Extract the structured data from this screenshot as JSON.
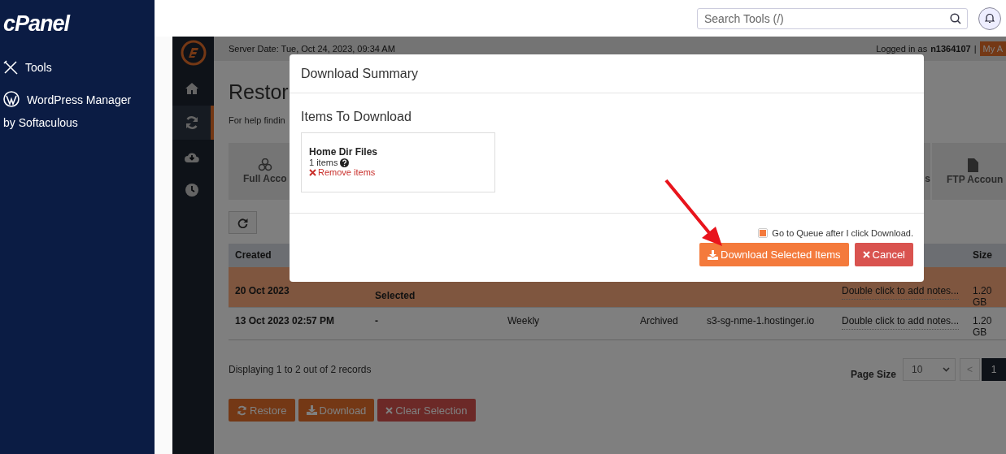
{
  "sidebar": {
    "logo": "cPanel",
    "items": [
      {
        "kind": "tools",
        "label": "Tools"
      },
      {
        "kind": "wordpress",
        "label": "WordPress Manager by Softaculous"
      }
    ]
  },
  "topbar": {
    "search": {
      "placeholder": "Search Tools (/)"
    }
  },
  "app_nav": {
    "items": [
      {
        "kind": "home",
        "selected": false
      },
      {
        "kind": "restore",
        "selected": true
      },
      {
        "kind": "download",
        "selected": false
      },
      {
        "kind": "schedule",
        "selected": false
      }
    ]
  },
  "server_bar": {
    "server_date": "Server Date: Tue, Oct 24, 2023, 09:34 AM",
    "logged_in_label": "Logged in as",
    "username": "n1364107",
    "separator": "|",
    "account_button": "My A"
  },
  "page": {
    "title": "Restor",
    "help": "For help findin"
  },
  "backup_tabs": [
    {
      "kind": "full",
      "label": "Full Acco"
    },
    {
      "kind": "plain",
      "label": "s"
    },
    {
      "kind": "file",
      "label": "FTP Accoun"
    }
  ],
  "table": {
    "created_label": "Created",
    "size_label": "Size",
    "rows": [
      {
        "selected": true,
        "created": "20 Oct 2023",
        "column_2": "Selected",
        "notes": "Double click to add notes...",
        "size": "1.20 GB"
      },
      {
        "selected": false,
        "created": "13 Oct 2023 02:57 PM",
        "column_2": "-",
        "type": "Weekly",
        "status": "Archived",
        "server": "s3-sg-nme-1.hostinger.io",
        "notes": "Double click to add notes...",
        "size": "1.20 GB"
      }
    ]
  },
  "records": "Displaying 1 to 2 out of 2 records",
  "pagination": {
    "page_size_label": "Page Size",
    "page_size": "10",
    "prev": "<",
    "pages": [
      {
        "label": "1",
        "selected": true
      }
    ]
  },
  "actions": [
    {
      "kind": "restore",
      "label": "Restore"
    },
    {
      "kind": "download",
      "label": "Download"
    },
    {
      "kind": "clear",
      "label": "Clear Selection"
    }
  ],
  "modal": {
    "title": "Download Summary",
    "section_title": "Items To Download",
    "items": [
      {
        "name": "Home Dir Files",
        "count": "1 items",
        "remove": "Remove items"
      }
    ],
    "queue_option": {
      "label": "Go to Queue after I click Download.",
      "checked": true
    },
    "buttons": [
      {
        "kind": "primary",
        "label": "Download Selected Items"
      },
      {
        "kind": "cancel",
        "label": "Cancel"
      }
    ]
  }
}
